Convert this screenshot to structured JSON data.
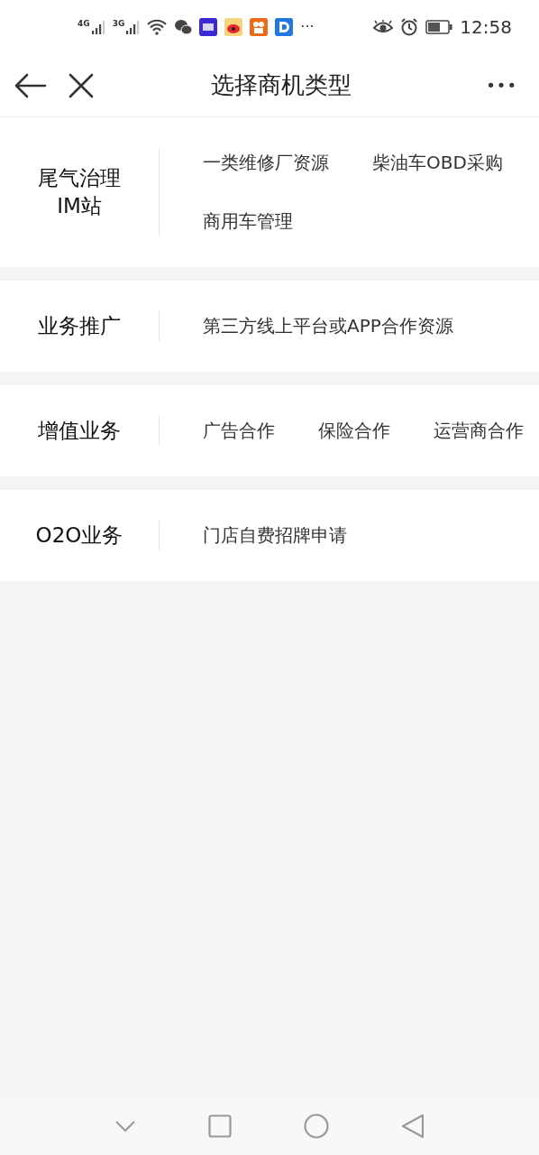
{
  "status_bar": {
    "signals": [
      "4G",
      "3G"
    ],
    "more": "···",
    "time": "12:58"
  },
  "header": {
    "title": "选择商机类型",
    "more": "•••"
  },
  "categories": [
    {
      "name": "尾气治理\nIM站",
      "options": [
        "一类维修厂资源",
        "柴油车OBD采购",
        "商用车管理"
      ]
    },
    {
      "name": "业务推广",
      "options": [
        "第三方线上平台或APP合作资源"
      ]
    },
    {
      "name": "增值业务",
      "options": [
        "广告合作",
        "保险合作",
        "运营商合作"
      ]
    },
    {
      "name": "O2O业务",
      "options": [
        "门店自费招牌申请"
      ]
    }
  ]
}
